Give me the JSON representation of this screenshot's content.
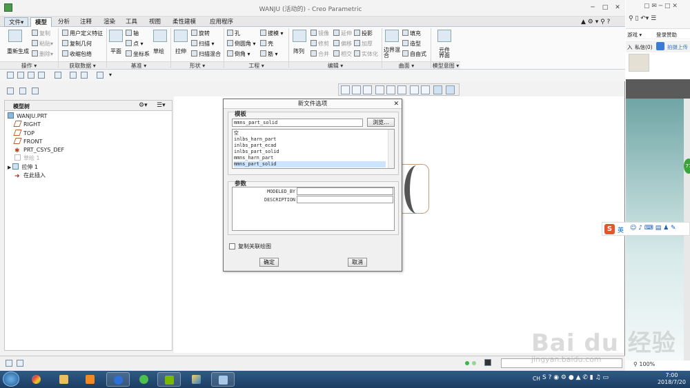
{
  "window": {
    "title": "WANJU (活动的) - Creo Parametric",
    "min": "─",
    "max": "□",
    "close": "✕"
  },
  "tabs": [
    {
      "label": "文件▾"
    },
    {
      "label": "模型"
    },
    {
      "label": "分析"
    },
    {
      "label": "注释"
    },
    {
      "label": "渲染"
    },
    {
      "label": "工具"
    },
    {
      "label": "视图"
    },
    {
      "label": "柔性建模"
    },
    {
      "label": "应用程序"
    }
  ],
  "ribbon": {
    "regen": "重新生成",
    "copy": "复制",
    "paste": "粘贴▾",
    "delete": "删除▾",
    "udf": "用户定义特征",
    "copygeom": "复制几何",
    "shrinkwrap": "收缩包络",
    "plane": "平面",
    "axis": "轴",
    "point": "点 ▾",
    "csys": "坐标系",
    "sketch": "草绘",
    "extrude": "拉伸",
    "revolve": "旋转",
    "sweep": "扫描 ▾",
    "sweptblend": "扫描混合",
    "hole": "孔",
    "round": "倒圆角 ▾",
    "chamfer": "倒角 ▾",
    "draft": "拔模 ▾",
    "shell": "壳",
    "rib": "筋 ▾",
    "pattern": "阵列",
    "mirror": "镜像",
    "trim": "修剪",
    "merge": "合并",
    "extend": "延伸",
    "offset": "偏移",
    "intersect": "相交",
    "project": "投影",
    "thicken": "加厚",
    "solidify": "实体化",
    "boundary": "边界混合",
    "fill": "填充",
    "style": "造型",
    "freestyle": "自由式",
    "compintf": "元件界面",
    "groups": {
      "ops": "操作 ▾",
      "getdata": "获取数据 ▾",
      "datum": "基准 ▾",
      "shapes": "形状 ▾",
      "eng": "工程 ▾",
      "edit": "编辑 ▾",
      "surfaces": "曲面 ▾",
      "intent": "模型意图 ▾"
    }
  },
  "tree": {
    "header": "模型树",
    "items": [
      {
        "label": "WANJU.PRT"
      },
      {
        "label": "RIGHT"
      },
      {
        "label": "TOP"
      },
      {
        "label": "FRONT"
      },
      {
        "label": "PRT_CSYS_DEF"
      },
      {
        "label": "草绘 1"
      },
      {
        "label": "拉伸 1"
      },
      {
        "label": "在此插入"
      }
    ]
  },
  "dialog": {
    "title": "新文件选项",
    "template_label": "模板",
    "template_value": "mmns_part_solid",
    "browse": "浏览...",
    "list": [
      "空",
      "inlbs_harn_part",
      "inlbs_part_ecad",
      "inlbs_part_solid",
      "mmns_harn_part",
      "mmns_part_solid"
    ],
    "selected": "mmns_part_solid",
    "params_label": "参数",
    "params": [
      {
        "name": "MODELED_BY"
      },
      {
        "name": "DESCRIPTION"
      }
    ],
    "copy_drawing": "复制关联绘图",
    "ok": "确定",
    "cancel": "取消"
  },
  "rightwin": {
    "games": "游戏 ▾",
    "login": "登录赞助",
    "tab1": "入",
    "tab2": "私信(0)",
    "tab3": "拍摄上传",
    "ime": "英"
  },
  "taskbar": {
    "lang": "CH",
    "time": "7:00",
    "date": "2018/7/20"
  },
  "watermark": {
    "text": "Bai du 经验",
    "url": "jingyan.baidu.com"
  },
  "status": {
    "zoom": "100%"
  }
}
